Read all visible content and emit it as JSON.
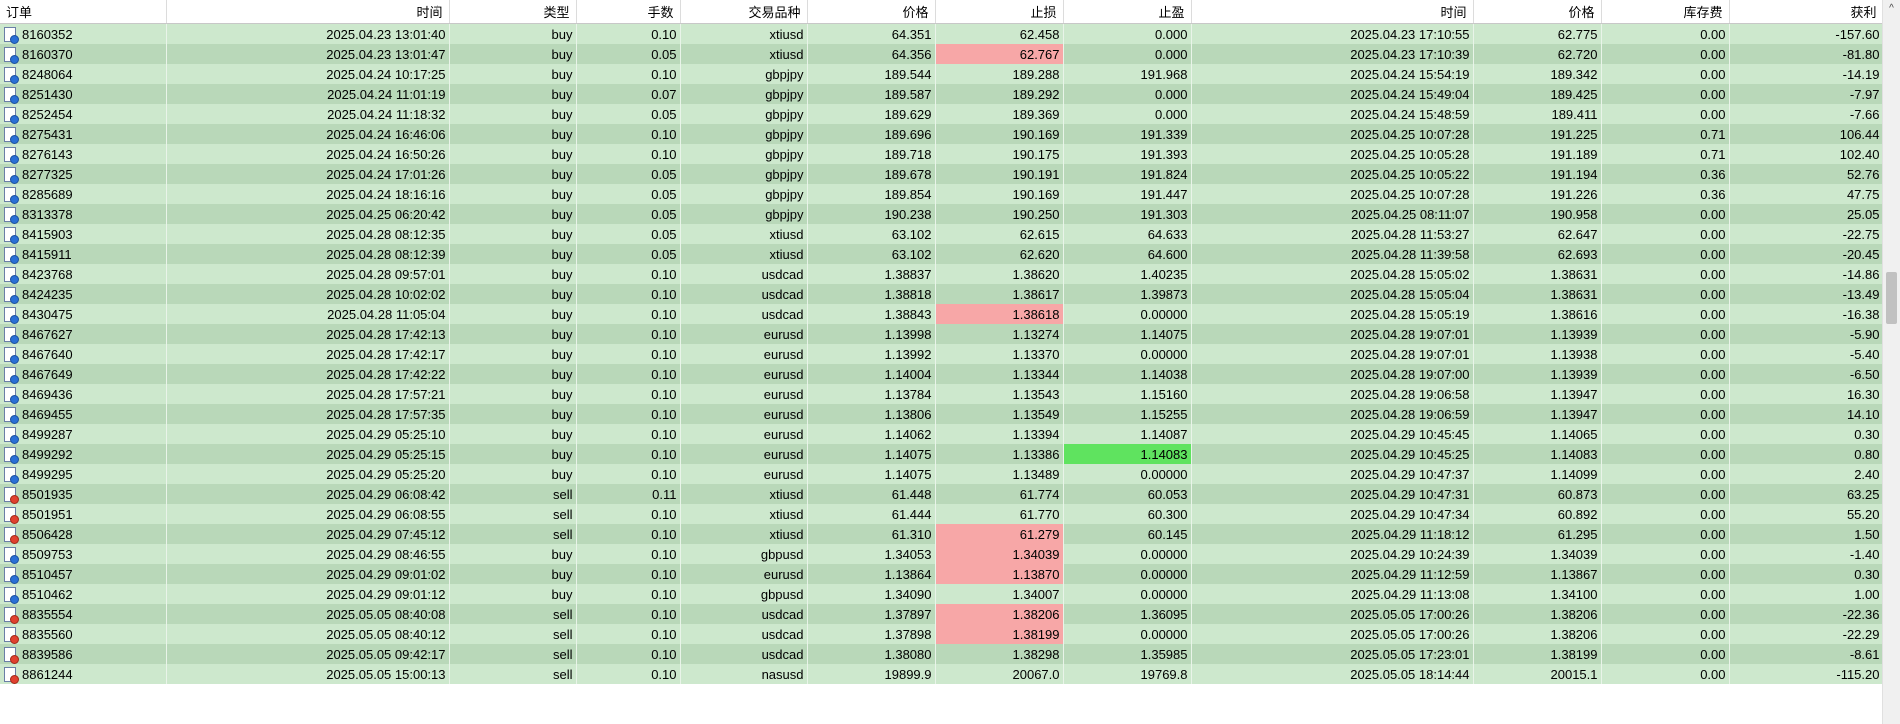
{
  "columns": [
    {
      "key": "order",
      "label": "订单"
    },
    {
      "key": "time",
      "label": "时间"
    },
    {
      "key": "type",
      "label": "类型"
    },
    {
      "key": "volume",
      "label": "手数"
    },
    {
      "key": "symbol",
      "label": "交易品种"
    },
    {
      "key": "price",
      "label": "价格"
    },
    {
      "key": "sl",
      "label": "止损"
    },
    {
      "key": "tp",
      "label": "止盈"
    },
    {
      "key": "close_time",
      "label": "时间"
    },
    {
      "key": "close_price",
      "label": "价格"
    },
    {
      "key": "swap",
      "label": "库存费"
    },
    {
      "key": "profit",
      "label": "获利"
    }
  ],
  "sort_indicator": "/",
  "scroll_up_glyph": "^",
  "highlight_colors": {
    "loss": "#f7a7a7",
    "profit": "#5fe35f"
  },
  "rows": [
    {
      "order": "8160352",
      "time": "2025.04.23 13:01:40",
      "type": "buy",
      "volume": "0.10",
      "symbol": "xtiusd",
      "price": "64.351",
      "sl": "62.458",
      "tp": "0.000",
      "close_time": "2025.04.23 17:10:55",
      "close_price": "62.775",
      "swap": "0.00",
      "profit": "-157.60",
      "hl": ""
    },
    {
      "order": "8160370",
      "time": "2025.04.23 13:01:47",
      "type": "buy",
      "volume": "0.05",
      "symbol": "xtiusd",
      "price": "64.356",
      "sl": "62.767",
      "tp": "0.000",
      "close_time": "2025.04.23 17:10:39",
      "close_price": "62.720",
      "swap": "0.00",
      "profit": "-81.80",
      "hl": "sl"
    },
    {
      "order": "8248064",
      "time": "2025.04.24 10:17:25",
      "type": "buy",
      "volume": "0.10",
      "symbol": "gbpjpy",
      "price": "189.544",
      "sl": "189.288",
      "tp": "191.968",
      "close_time": "2025.04.24 15:54:19",
      "close_price": "189.342",
      "swap": "0.00",
      "profit": "-14.19",
      "hl": ""
    },
    {
      "order": "8251430",
      "time": "2025.04.24 11:01:19",
      "type": "buy",
      "volume": "0.07",
      "symbol": "gbpjpy",
      "price": "189.587",
      "sl": "189.292",
      "tp": "0.000",
      "close_time": "2025.04.24 15:49:04",
      "close_price": "189.425",
      "swap": "0.00",
      "profit": "-7.97",
      "hl": ""
    },
    {
      "order": "8252454",
      "time": "2025.04.24 11:18:32",
      "type": "buy",
      "volume": "0.05",
      "symbol": "gbpjpy",
      "price": "189.629",
      "sl": "189.369",
      "tp": "0.000",
      "close_time": "2025.04.24 15:48:59",
      "close_price": "189.411",
      "swap": "0.00",
      "profit": "-7.66",
      "hl": ""
    },
    {
      "order": "8275431",
      "time": "2025.04.24 16:46:06",
      "type": "buy",
      "volume": "0.10",
      "symbol": "gbpjpy",
      "price": "189.696",
      "sl": "190.169",
      "tp": "191.339",
      "close_time": "2025.04.25 10:07:28",
      "close_price": "191.225",
      "swap": "0.71",
      "profit": "106.44",
      "hl": ""
    },
    {
      "order": "8276143",
      "time": "2025.04.24 16:50:26",
      "type": "buy",
      "volume": "0.10",
      "symbol": "gbpjpy",
      "price": "189.718",
      "sl": "190.175",
      "tp": "191.393",
      "close_time": "2025.04.25 10:05:28",
      "close_price": "191.189",
      "swap": "0.71",
      "profit": "102.40",
      "hl": ""
    },
    {
      "order": "8277325",
      "time": "2025.04.24 17:01:26",
      "type": "buy",
      "volume": "0.05",
      "symbol": "gbpjpy",
      "price": "189.678",
      "sl": "190.191",
      "tp": "191.824",
      "close_time": "2025.04.25 10:05:22",
      "close_price": "191.194",
      "swap": "0.36",
      "profit": "52.76",
      "hl": ""
    },
    {
      "order": "8285689",
      "time": "2025.04.24 18:16:16",
      "type": "buy",
      "volume": "0.05",
      "symbol": "gbpjpy",
      "price": "189.854",
      "sl": "190.169",
      "tp": "191.447",
      "close_time": "2025.04.25 10:07:28",
      "close_price": "191.226",
      "swap": "0.36",
      "profit": "47.75",
      "hl": ""
    },
    {
      "order": "8313378",
      "time": "2025.04.25 06:20:42",
      "type": "buy",
      "volume": "0.05",
      "symbol": "gbpjpy",
      "price": "190.238",
      "sl": "190.250",
      "tp": "191.303",
      "close_time": "2025.04.25 08:11:07",
      "close_price": "190.958",
      "swap": "0.00",
      "profit": "25.05",
      "hl": ""
    },
    {
      "order": "8415903",
      "time": "2025.04.28 08:12:35",
      "type": "buy",
      "volume": "0.05",
      "symbol": "xtiusd",
      "price": "63.102",
      "sl": "62.615",
      "tp": "64.633",
      "close_time": "2025.04.28 11:53:27",
      "close_price": "62.647",
      "swap": "0.00",
      "profit": "-22.75",
      "hl": ""
    },
    {
      "order": "8415911",
      "time": "2025.04.28 08:12:39",
      "type": "buy",
      "volume": "0.05",
      "symbol": "xtiusd",
      "price": "63.102",
      "sl": "62.620",
      "tp": "64.600",
      "close_time": "2025.04.28 11:39:58",
      "close_price": "62.693",
      "swap": "0.00",
      "profit": "-20.45",
      "hl": ""
    },
    {
      "order": "8423768",
      "time": "2025.04.28 09:57:01",
      "type": "buy",
      "volume": "0.10",
      "symbol": "usdcad",
      "price": "1.38837",
      "sl": "1.38620",
      "tp": "1.40235",
      "close_time": "2025.04.28 15:05:02",
      "close_price": "1.38631",
      "swap": "0.00",
      "profit": "-14.86",
      "hl": ""
    },
    {
      "order": "8424235",
      "time": "2025.04.28 10:02:02",
      "type": "buy",
      "volume": "0.10",
      "symbol": "usdcad",
      "price": "1.38818",
      "sl": "1.38617",
      "tp": "1.39873",
      "close_time": "2025.04.28 15:05:04",
      "close_price": "1.38631",
      "swap": "0.00",
      "profit": "-13.49",
      "hl": ""
    },
    {
      "order": "8430475",
      "time": "2025.04.28 11:05:04",
      "type": "buy",
      "volume": "0.10",
      "symbol": "usdcad",
      "price": "1.38843",
      "sl": "1.38618",
      "tp": "0.00000",
      "close_time": "2025.04.28 15:05:19",
      "close_price": "1.38616",
      "swap": "0.00",
      "profit": "-16.38",
      "hl": "sl"
    },
    {
      "order": "8467627",
      "time": "2025.04.28 17:42:13",
      "type": "buy",
      "volume": "0.10",
      "symbol": "eurusd",
      "price": "1.13998",
      "sl": "1.13274",
      "tp": "1.14075",
      "close_time": "2025.04.28 19:07:01",
      "close_price": "1.13939",
      "swap": "0.00",
      "profit": "-5.90",
      "hl": ""
    },
    {
      "order": "8467640",
      "time": "2025.04.28 17:42:17",
      "type": "buy",
      "volume": "0.10",
      "symbol": "eurusd",
      "price": "1.13992",
      "sl": "1.13370",
      "tp": "0.00000",
      "close_time": "2025.04.28 19:07:01",
      "close_price": "1.13938",
      "swap": "0.00",
      "profit": "-5.40",
      "hl": ""
    },
    {
      "order": "8467649",
      "time": "2025.04.28 17:42:22",
      "type": "buy",
      "volume": "0.10",
      "symbol": "eurusd",
      "price": "1.14004",
      "sl": "1.13344",
      "tp": "1.14038",
      "close_time": "2025.04.28 19:07:00",
      "close_price": "1.13939",
      "swap": "0.00",
      "profit": "-6.50",
      "hl": ""
    },
    {
      "order": "8469436",
      "time": "2025.04.28 17:57:21",
      "type": "buy",
      "volume": "0.10",
      "symbol": "eurusd",
      "price": "1.13784",
      "sl": "1.13543",
      "tp": "1.15160",
      "close_time": "2025.04.28 19:06:58",
      "close_price": "1.13947",
      "swap": "0.00",
      "profit": "16.30",
      "hl": ""
    },
    {
      "order": "8469455",
      "time": "2025.04.28 17:57:35",
      "type": "buy",
      "volume": "0.10",
      "symbol": "eurusd",
      "price": "1.13806",
      "sl": "1.13549",
      "tp": "1.15255",
      "close_time": "2025.04.28 19:06:59",
      "close_price": "1.13947",
      "swap": "0.00",
      "profit": "14.10",
      "hl": ""
    },
    {
      "order": "8499287",
      "time": "2025.04.29 05:25:10",
      "type": "buy",
      "volume": "0.10",
      "symbol": "eurusd",
      "price": "1.14062",
      "sl": "1.13394",
      "tp": "1.14087",
      "close_time": "2025.04.29 10:45:45",
      "close_price": "1.14065",
      "swap": "0.00",
      "profit": "0.30",
      "hl": ""
    },
    {
      "order": "8499292",
      "time": "2025.04.29 05:25:15",
      "type": "buy",
      "volume": "0.10",
      "symbol": "eurusd",
      "price": "1.14075",
      "sl": "1.13386",
      "tp": "1.14083",
      "close_time": "2025.04.29 10:45:25",
      "close_price": "1.14083",
      "swap": "0.00",
      "profit": "0.80",
      "hl": "tp"
    },
    {
      "order": "8499295",
      "time": "2025.04.29 05:25:20",
      "type": "buy",
      "volume": "0.10",
      "symbol": "eurusd",
      "price": "1.14075",
      "sl": "1.13489",
      "tp": "0.00000",
      "close_time": "2025.04.29 10:47:37",
      "close_price": "1.14099",
      "swap": "0.00",
      "profit": "2.40",
      "hl": ""
    },
    {
      "order": "8501935",
      "time": "2025.04.29 06:08:42",
      "type": "sell",
      "volume": "0.11",
      "symbol": "xtiusd",
      "price": "61.448",
      "sl": "61.774",
      "tp": "60.053",
      "close_time": "2025.04.29 10:47:31",
      "close_price": "60.873",
      "swap": "0.00",
      "profit": "63.25",
      "hl": ""
    },
    {
      "order": "8501951",
      "time": "2025.04.29 06:08:55",
      "type": "sell",
      "volume": "0.10",
      "symbol": "xtiusd",
      "price": "61.444",
      "sl": "61.770",
      "tp": "60.300",
      "close_time": "2025.04.29 10:47:34",
      "close_price": "60.892",
      "swap": "0.00",
      "profit": "55.20",
      "hl": ""
    },
    {
      "order": "8506428",
      "time": "2025.04.29 07:45:12",
      "type": "sell",
      "volume": "0.10",
      "symbol": "xtiusd",
      "price": "61.310",
      "sl": "61.279",
      "tp": "60.145",
      "close_time": "2025.04.29 11:18:12",
      "close_price": "61.295",
      "swap": "0.00",
      "profit": "1.50",
      "hl": "sl"
    },
    {
      "order": "8509753",
      "time": "2025.04.29 08:46:55",
      "type": "buy",
      "volume": "0.10",
      "symbol": "gbpusd",
      "price": "1.34053",
      "sl": "1.34039",
      "tp": "0.00000",
      "close_time": "2025.04.29 10:24:39",
      "close_price": "1.34039",
      "swap": "0.00",
      "profit": "-1.40",
      "hl": "sl"
    },
    {
      "order": "8510457",
      "time": "2025.04.29 09:01:02",
      "type": "buy",
      "volume": "0.10",
      "symbol": "eurusd",
      "price": "1.13864",
      "sl": "1.13870",
      "tp": "0.00000",
      "close_time": "2025.04.29 11:12:59",
      "close_price": "1.13867",
      "swap": "0.00",
      "profit": "0.30",
      "hl": "sl"
    },
    {
      "order": "8510462",
      "time": "2025.04.29 09:01:12",
      "type": "buy",
      "volume": "0.10",
      "symbol": "gbpusd",
      "price": "1.34090",
      "sl": "1.34007",
      "tp": "0.00000",
      "close_time": "2025.04.29 11:13:08",
      "close_price": "1.34100",
      "swap": "0.00",
      "profit": "1.00",
      "hl": ""
    },
    {
      "order": "8835554",
      "time": "2025.05.05 08:40:08",
      "type": "sell",
      "volume": "0.10",
      "symbol": "usdcad",
      "price": "1.37897",
      "sl": "1.38206",
      "tp": "1.36095",
      "close_time": "2025.05.05 17:00:26",
      "close_price": "1.38206",
      "swap": "0.00",
      "profit": "-22.36",
      "hl": "sl"
    },
    {
      "order": "8835560",
      "time": "2025.05.05 08:40:12",
      "type": "sell",
      "volume": "0.10",
      "symbol": "usdcad",
      "price": "1.37898",
      "sl": "1.38199",
      "tp": "0.00000",
      "close_time": "2025.05.05 17:00:26",
      "close_price": "1.38206",
      "swap": "0.00",
      "profit": "-22.29",
      "hl": "sl"
    },
    {
      "order": "8839586",
      "time": "2025.05.05 09:42:17",
      "type": "sell",
      "volume": "0.10",
      "symbol": "usdcad",
      "price": "1.38080",
      "sl": "1.38298",
      "tp": "1.35985",
      "close_time": "2025.05.05 17:23:01",
      "close_price": "1.38199",
      "swap": "0.00",
      "profit": "-8.61",
      "hl": ""
    },
    {
      "order": "8861244",
      "time": "2025.05.05 15:00:13",
      "type": "sell",
      "volume": "0.10",
      "symbol": "nasusd",
      "price": "19899.9",
      "sl": "20067.0",
      "tp": "19769.8",
      "close_time": "2025.05.05 18:14:44",
      "close_price": "20015.1",
      "swap": "0.00",
      "profit": "-115.20",
      "hl": ""
    }
  ]
}
